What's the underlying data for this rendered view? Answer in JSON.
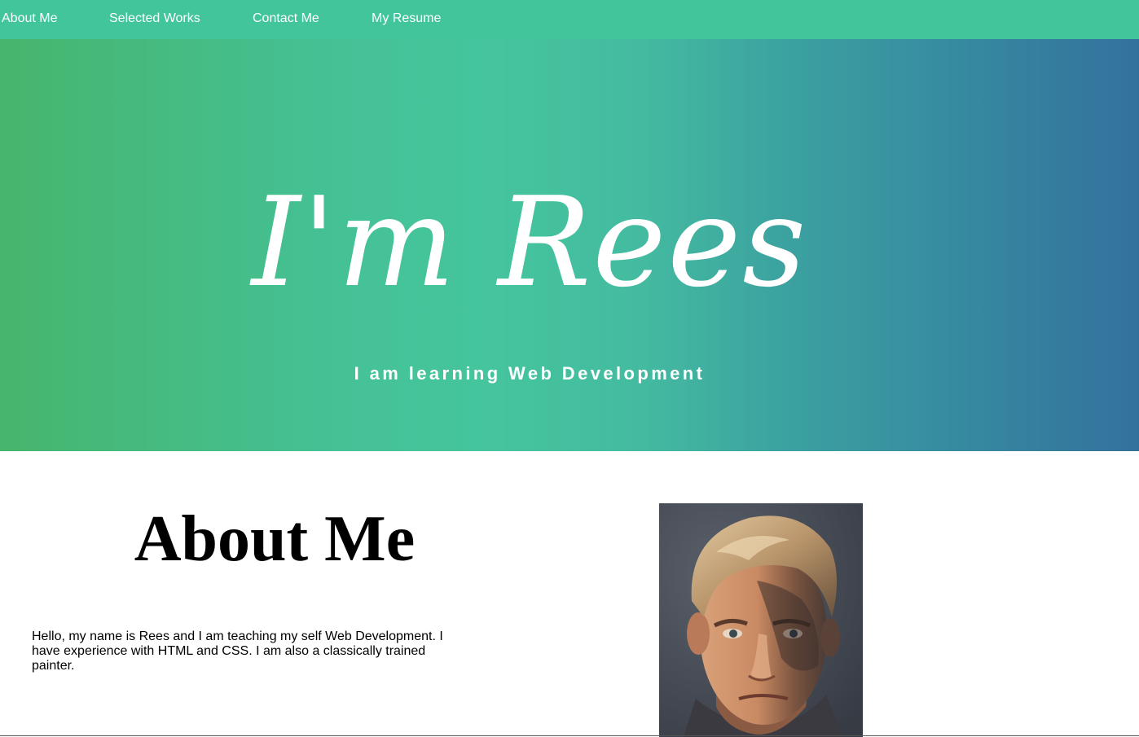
{
  "nav": {
    "items": [
      {
        "label": "About Me"
      },
      {
        "label": "Selected Works"
      },
      {
        "label": "Contact Me"
      },
      {
        "label": "My Resume"
      }
    ]
  },
  "hero": {
    "title": "I'm Rees",
    "subtitle": "I am learning Web Development"
  },
  "about": {
    "heading": "About Me",
    "text": "Hello, my name is Rees and I am teaching my self Web Development. I have experience with HTML and CSS. I am also a classically trained painter."
  },
  "colors": {
    "nav_background": "#43c59b",
    "hero_gradient_start": "#46b56d",
    "hero_gradient_mid": "#45c59d",
    "hero_gradient_end": "#33719d",
    "text_on_hero": "#ffffff"
  }
}
